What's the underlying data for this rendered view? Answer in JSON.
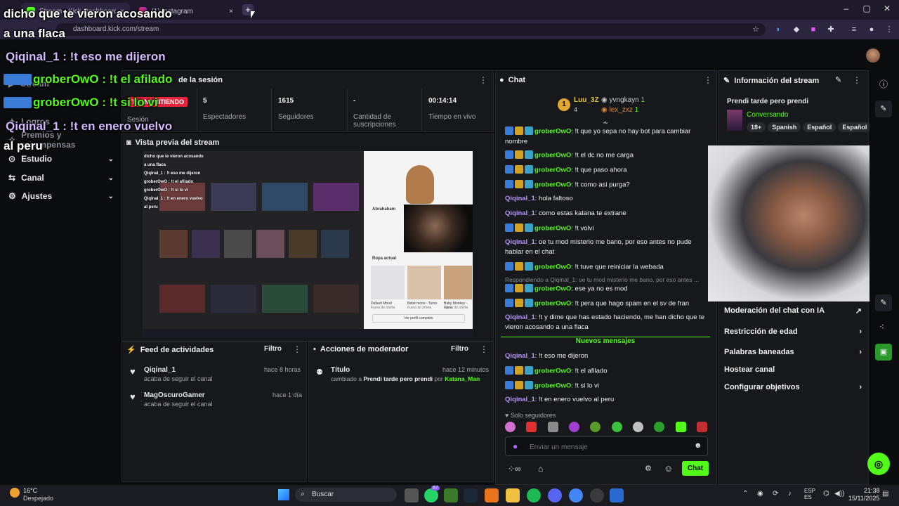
{
  "browser": {
    "tabs": [
      {
        "label": "Stream - Kick Dashboard",
        "close": "×"
      },
      {
        "label": "(1) Instagram",
        "close": "×"
      }
    ],
    "new_tab": "+",
    "url": "dashboard.kick.com/stream"
  },
  "sidebar": {
    "items": [
      {
        "label": "Stream"
      },
      {
        "label": "Logros"
      },
      {
        "label": "Premios y recompensas"
      },
      {
        "label": "Estudio"
      },
      {
        "label": "Canal"
      },
      {
        "label": "Ajustes"
      }
    ]
  },
  "session": {
    "title": "de la sesión",
    "status_badge": "TRANSMITIENDO",
    "session_label": "Sesión",
    "stats": [
      {
        "value": "5",
        "label": "Espectadores"
      },
      {
        "value": "1615",
        "label": "Seguidores"
      },
      {
        "value": "-",
        "label": "Cantidad de suscripciones"
      },
      {
        "value": "00:14:14",
        "label": "Tiempo en vivo"
      }
    ]
  },
  "preview": {
    "title": "Vista previa del stream",
    "overlay_lines": [
      "dicho que te vieron acosando",
      "a una flaca",
      "Qiqinal_1 : !t eso me dijeron",
      "groberOwO : !t el afilado",
      "groberOwO : !t si lo vi",
      "Qiqinal_1 : !t en enero vuelvo",
      "al peru"
    ],
    "store": {
      "user": "Abrahaham",
      "section": "Ropa actual",
      "items": [
        {
          "name": "Default Mood",
          "sub": "Fuera de oferta"
        },
        {
          "name": "Bebé mono - Torso",
          "sub": "Fuera de oferta"
        },
        {
          "name": "Baby Monkey - Dyna",
          "sub": "Fuera de oferta"
        }
      ],
      "button": "Ver perfil completo"
    }
  },
  "activity": {
    "title": "Feed de actividades",
    "filter": "Filtro",
    "items": [
      {
        "user": "Qiqinal_1",
        "action": "acaba de seguir el canal",
        "time": "hace 8 horas"
      },
      {
        "user": "MagOscuroGamer",
        "action": "acaba de seguir el canal",
        "time": "hace 1 día"
      }
    ]
  },
  "modactions": {
    "title": "Acciones de moderador",
    "filter": "Filtro",
    "item": {
      "label": "Título",
      "time": "hace 12 minutos",
      "pre": "cambiado a",
      "value": "Prendi tarde pero prendi",
      "by": "por",
      "user": "Katana_Man"
    }
  },
  "chat": {
    "title": "Chat",
    "top_users": [
      {
        "rank": "1",
        "name": "Luu_3Z",
        "count": "4"
      },
      {
        "name": "yvngkayn",
        "count": "1"
      },
      {
        "name": "lex_zxz",
        "count": "1"
      }
    ],
    "messages": [
      {
        "user": "groberOwO",
        "text": "!t que yo sepa no hay bot para cambiar nombre",
        "badges": true,
        "color": "green"
      },
      {
        "user": "groberOwO",
        "text": "!t el dc no me carga",
        "badges": true,
        "color": "green"
      },
      {
        "user": "groberOwO",
        "text": "!t que paso ahora",
        "badges": true,
        "color": "green"
      },
      {
        "user": "groberOwO",
        "text": "!t como asi purga?",
        "badges": true,
        "color": "green"
      },
      {
        "user": "Qiqinal_1",
        "text": "hola faltoso",
        "badges": false,
        "color": "purple"
      },
      {
        "user": "Qiqinal_1",
        "text": "como estas katana te extrane",
        "badges": false,
        "color": "purple"
      },
      {
        "user": "groberOwO",
        "text": "!t volvi",
        "badges": true,
        "color": "green"
      },
      {
        "user": "Qiqinal_1",
        "text": "oe tu mod misterio me bano, por eso antes no pude hablar en el chat",
        "badges": false,
        "color": "purple"
      },
      {
        "user": "groberOwO",
        "text": "!t tuve que reiniciar la webada",
        "badges": true,
        "color": "green"
      }
    ],
    "reply_ref": "Respondiendo a Qiqinal_1: oe tu mod misterio me bano, por eso antes ...",
    "messages2": [
      {
        "user": "groberOwO",
        "text": "ese ya no es mod",
        "badges": true,
        "color": "green"
      },
      {
        "user": "groberOwO",
        "text": "!t pera que hago spam en el sv de fran",
        "badges": true,
        "color": "green"
      },
      {
        "user": "Qiqinal_1",
        "text": "!t y dime que has estado haciendo, me han dicho que te vieron acosando a una flaca",
        "badges": false,
        "color": "purple"
      }
    ],
    "new_messages": "Nuevos mensajes",
    "messages3": [
      {
        "user": "Qiqinal_1",
        "text": "!t eso me dijeron",
        "badges": false,
        "color": "purple"
      },
      {
        "user": "groberOwO",
        "text": "!t el afilado",
        "badges": true,
        "color": "green"
      },
      {
        "user": "groberOwO",
        "text": "!t si lo vi",
        "badges": true,
        "color": "green"
      },
      {
        "user": "Qiqinal_1",
        "text": "!t en enero vuelvo al peru",
        "badges": false,
        "color": "purple"
      }
    ],
    "followers_only": "Solo seguidores",
    "input_placeholder": "Enviar un mensaje",
    "send_label": "Chat"
  },
  "streaminfo": {
    "title": "Información del stream",
    "stream_title": "Prendi tarde pero prendi",
    "category": "Conversando",
    "tags": [
      "18+",
      "Spanish",
      "Español",
      "Español"
    ],
    "menu": [
      {
        "label": "Moderación del chat con IA"
      },
      {
        "label": "Restricción de edad"
      },
      {
        "label": "Palabras baneadas"
      },
      {
        "label": "Hostear canal"
      },
      {
        "label": "Configurar objetivos"
      }
    ]
  },
  "overlay": {
    "lines": [
      {
        "text": "dicho que te vieron acosando"
      },
      {
        "text": "a una flaca"
      },
      {
        "text": "Qiqinal_1 : !t eso me dijeron"
      },
      {
        "text": "groberOwO : !t el afilado"
      },
      {
        "text": "groberOwO : !t si lo vi"
      },
      {
        "text": "Qiqinal_1 : !t en enero vuelvo"
      },
      {
        "text": "al peru"
      }
    ]
  },
  "taskbar": {
    "weather_temp": "16°C",
    "weather_desc": "Despejado",
    "search": "Buscar",
    "lang1": "ESP",
    "lang2": "ES",
    "time": "21:38",
    "date": "15/11/2025",
    "badge": "57"
  },
  "colors": {
    "accent": "#53fc18",
    "purple_user": "#b896ff",
    "live_red": "#e5243b"
  }
}
